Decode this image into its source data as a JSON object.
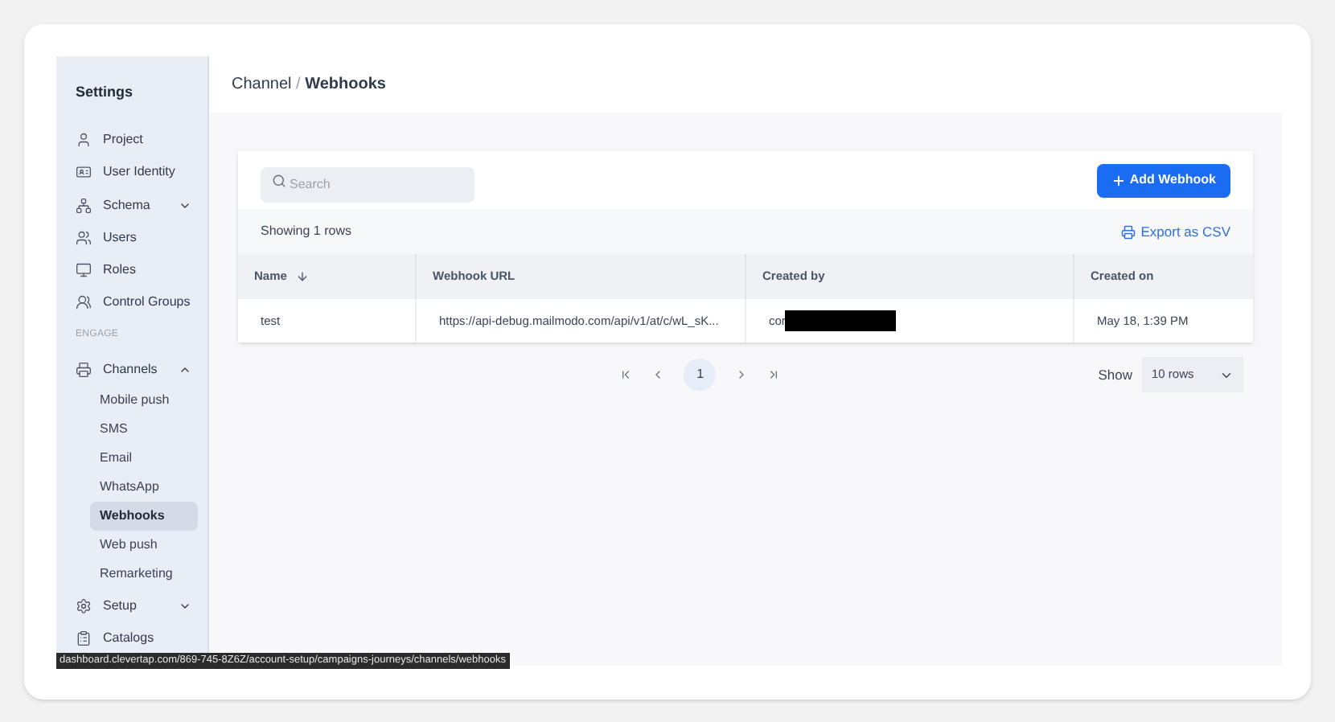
{
  "sidebar": {
    "title": "Settings",
    "items": [
      {
        "kind": "item",
        "label": "Project"
      },
      {
        "kind": "item",
        "label": "User Identity"
      },
      {
        "kind": "group",
        "label": "Schema",
        "expanded": false
      },
      {
        "kind": "item",
        "label": "Users"
      },
      {
        "kind": "item",
        "label": "Roles"
      },
      {
        "kind": "item",
        "label": "Control Groups"
      },
      {
        "kind": "heading",
        "label": "ENGAGE"
      },
      {
        "kind": "group",
        "label": "Channels",
        "expanded": true,
        "children": [
          {
            "label": "Mobile push",
            "selected": false
          },
          {
            "label": "SMS",
            "selected": false
          },
          {
            "label": "Email",
            "selected": false
          },
          {
            "label": "WhatsApp",
            "selected": false
          },
          {
            "label": "Webhooks",
            "selected": true
          },
          {
            "label": "Web push",
            "selected": false
          },
          {
            "label": "Remarketing",
            "selected": false
          }
        ]
      },
      {
        "kind": "group",
        "label": "Setup",
        "expanded": false
      },
      {
        "kind": "item",
        "label": "Catalogs"
      }
    ]
  },
  "breadcrumb": {
    "parent": "Channel",
    "separator": "/",
    "current": "Webhooks"
  },
  "search": {
    "placeholder": "Search"
  },
  "add_button": "Add Webhook",
  "row_count": "Showing 1 rows",
  "export": "Export as CSV",
  "table": {
    "columns": [
      "Name",
      "Webhook URL",
      "Created by",
      "Created on"
    ],
    "rows": [
      {
        "cells": [
          "test",
          "https://api-debug.mailmodo.com/api/v1/at/c/wL_sK...",
          "cor",
          "May 18, 1:39 PM"
        ],
        "redacted": true
      }
    ]
  },
  "pagination": {
    "pages": [
      {
        "label": "1",
        "selected": true
      }
    ],
    "show_label": "Show",
    "page_size": "10 rows"
  },
  "status_url": "dashboard.clevertap.com/869-745-8Z6Z/account-setup/campaigns-journeys/channels/webhooks"
}
